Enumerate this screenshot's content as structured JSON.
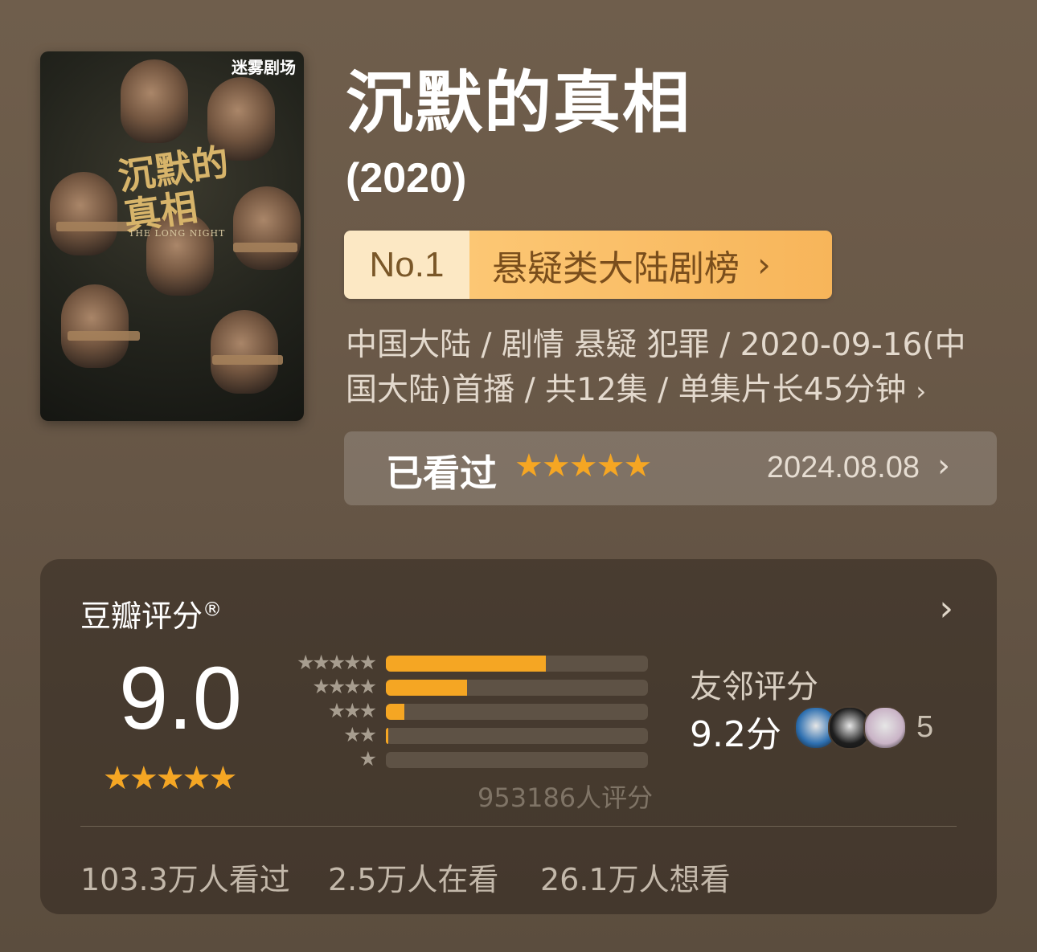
{
  "poster": {
    "brand": "迷雾剧场",
    "title": "沉默的真相",
    "subtitle": "THE LONG NIGHT"
  },
  "show": {
    "title": "沉默的真相",
    "year": "(2020)"
  },
  "rank": {
    "number": "No.1",
    "label": "悬疑类大陆剧榜",
    "chevron": "›"
  },
  "meta": {
    "line1": "中国大陆 / 剧情 悬疑 犯罪 / 2020-09-16(中",
    "line2": "国大陆)首播 / 共12集 / 单集片长45分钟",
    "chevron": "›"
  },
  "watched": {
    "label": "已看过",
    "stars": "★★★★★",
    "rating": 5,
    "date": "2024.08.08",
    "chevron": "›"
  },
  "douban": {
    "label": "豆瓣评分",
    "registered": "®",
    "chevron": "›",
    "score": "9.0",
    "stars_value": 4.5,
    "rating_count": "953186人评分",
    "distribution": [
      {
        "stars": "★★★★★",
        "fraction": 0.61
      },
      {
        "stars": "★★★★",
        "fraction": 0.31
      },
      {
        "stars": "★★★",
        "fraction": 0.07
      },
      {
        "stars": "★★",
        "fraction": 0.01
      },
      {
        "stars": "★",
        "fraction": 0.0
      }
    ],
    "neighbor_label": "友邻评分",
    "neighbor_score": "9.2分",
    "neighbor_count": "5",
    "avatar_colors": [
      "#2d6fb0",
      "#1e1e1e",
      "#c9b3c6"
    ]
  },
  "stats": {
    "watched": "103.3万人看过",
    "watching": "2.5万人在看",
    "want": "26.1万人想看"
  },
  "colors": {
    "accent": "#f5a623",
    "rank_badge": "#fce8c4",
    "rank_bar": "#fcc774"
  },
  "icons": {
    "chevron": "chevron-right-icon",
    "star": "star-icon"
  }
}
